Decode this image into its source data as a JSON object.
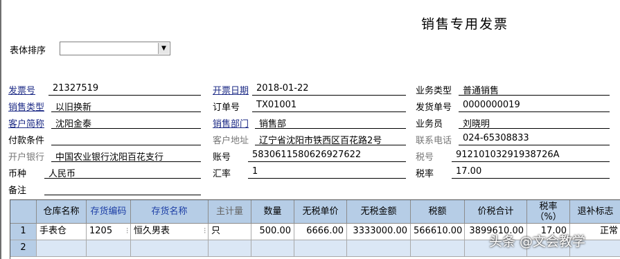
{
  "title": "销售专用发票",
  "sort": {
    "label": "表体排序",
    "value": ""
  },
  "fields": {
    "invoice_no": {
      "label": "发票号",
      "value": "21327519"
    },
    "invoice_date": {
      "label": "开票日期",
      "value": "2018-01-22"
    },
    "business_type": {
      "label": "业务类型",
      "value": "普通销售"
    },
    "sales_type": {
      "label": "销售类型",
      "value": "以旧换新"
    },
    "order_no": {
      "label": "订单号",
      "value": "TX01001"
    },
    "delivery_no": {
      "label": "发货单号",
      "value": "0000000019"
    },
    "customer_short": {
      "label": "客户简称",
      "value": "沈阳金泰"
    },
    "sales_dept": {
      "label": "销售部门",
      "value": "销售部"
    },
    "salesperson": {
      "label": "业务员",
      "value": "刘晓明"
    },
    "payment_terms": {
      "label": "付款条件",
      "value": ""
    },
    "customer_address": {
      "label": "客户地址",
      "value": "辽宁省沈阳市铁西区百花路2号"
    },
    "contact_phone": {
      "label": "联系电话",
      "value": "024-65308833"
    },
    "bank": {
      "label": "开户银行",
      "value": "中国农业银行沈阳百花支行"
    },
    "account": {
      "label": "账号",
      "value": "5830611580626927622"
    },
    "tax_no": {
      "label": "税号",
      "value": "91210103291938726A"
    },
    "currency": {
      "label": "币种",
      "value": "人民币"
    },
    "exchange_rate": {
      "label": "汇率",
      "value": "1"
    },
    "tax_rate": {
      "label": "税率",
      "value": "17.00"
    },
    "remark": {
      "label": "备注",
      "value": ""
    }
  },
  "table": {
    "headers": [
      "仓库名称",
      "存货编码",
      "存货名称",
      "主计量",
      "数量",
      "无税单价",
      "无税金额",
      "税额",
      "价税合计",
      "税率（%）",
      "退补标志"
    ],
    "rows": [
      {
        "num": "1",
        "cells": [
          "手表仓",
          "1205",
          "恒久男表",
          "只",
          "500.00",
          "6666.00",
          "3333000.00",
          "566610.00",
          "3899610.00",
          "17.00",
          "正常"
        ]
      },
      {
        "num": "2",
        "cells": [
          "",
          "",
          "",
          "",
          "",
          "",
          "",
          "",
          "",
          "",
          ""
        ]
      }
    ]
  },
  "watermark": "头条 @文会教学"
}
